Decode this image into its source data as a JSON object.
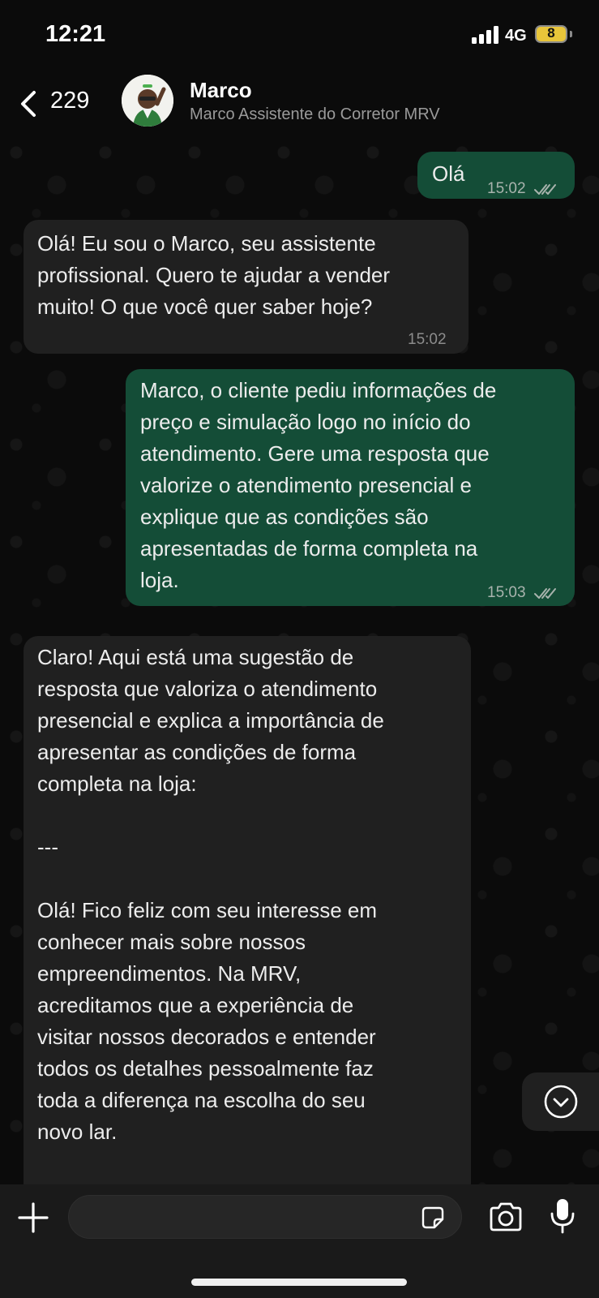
{
  "status_bar": {
    "time": "12:21",
    "network": "4G",
    "battery": "8"
  },
  "header": {
    "back_count": "229",
    "contact_name": "Marco",
    "contact_subtitle": "Marco Assistente do Corretor MRV"
  },
  "messages": [
    {
      "direction": "outgoing",
      "text": "Olá",
      "time": "15:02",
      "status": "read"
    },
    {
      "direction": "incoming",
      "text": "Olá! Eu sou o Marco, seu assistente\nprofissional. Quero te ajudar a vender\nmuito! O que você quer saber hoje?",
      "time": "15:02"
    },
    {
      "direction": "outgoing",
      "text": "Marco, o cliente pediu informações de\npreço e simulação logo no início do\natendimento. Gere uma resposta que\nvalorize o atendimento presencial e\nexplique que as condições são\napresentadas de forma completa na\nloja.",
      "time": "15:03",
      "status": "read"
    },
    {
      "direction": "incoming",
      "text": "Claro! Aqui está uma sugestão de\nresposta que valoriza o atendimento\npresencial e explica a importância de\napresentar as condições de forma\ncompleta na loja:\n\n---\n\nOlá! Fico feliz com seu interesse em\nconhecer mais sobre nossos\nempreendimentos. Na MRV,\nacreditamos que a experiência de\nvisitar nossos decorados e entender\ntodos os detalhes pessoalmente faz\ntoda a diferença na escolha do seu\nnovo lar."
    }
  ],
  "input": {
    "placeholder": ""
  },
  "icons": {
    "back": "chevron-left-icon",
    "scroll_down": "chevron-down-circle-icon",
    "attach": "plus-icon",
    "sticker": "sticker-icon",
    "camera": "camera-icon",
    "mic": "microphone-icon"
  },
  "colors": {
    "outgoing_bubble": "#144d37",
    "incoming_bubble": "#202020",
    "background": "#0b0b0b",
    "battery_fill": "#e8c53a"
  }
}
